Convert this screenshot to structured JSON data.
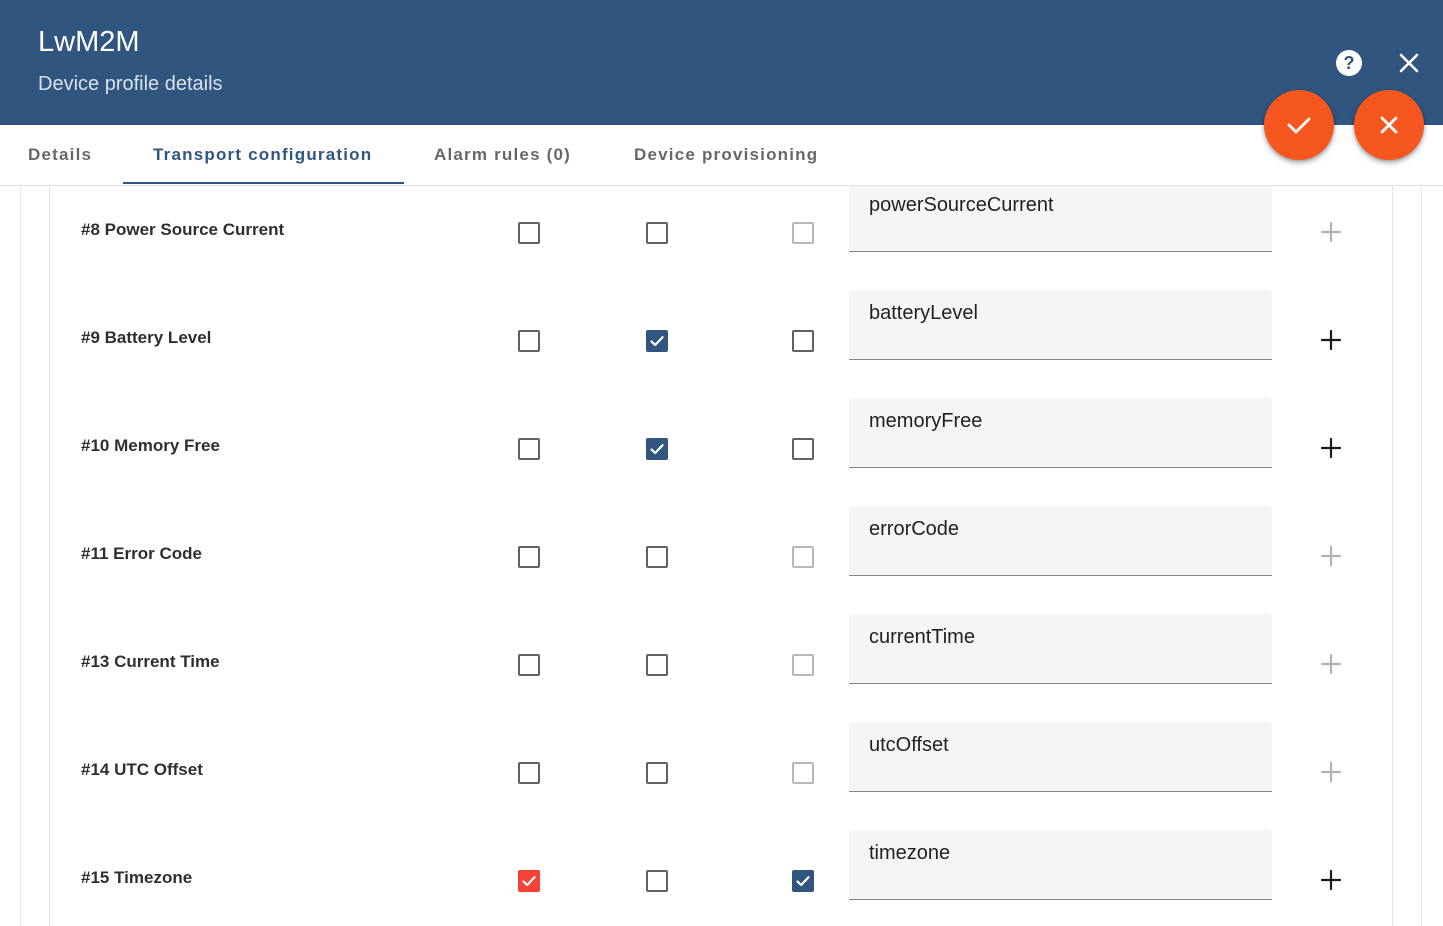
{
  "header": {
    "title": "LwM2M",
    "subtitle": "Device profile details",
    "help_icon": "help-circle-icon",
    "close_icon": "close-icon"
  },
  "fab": {
    "apply_icon": "check-icon",
    "cancel_icon": "close-icon",
    "color": "#f5571f"
  },
  "tabs": [
    {
      "label": "Details",
      "active": false
    },
    {
      "label": "Transport configuration",
      "active": true
    },
    {
      "label": "Alarm rules (0)",
      "active": false
    },
    {
      "label": "Device provisioning",
      "active": false
    }
  ],
  "colors": {
    "header_bg": "#305680",
    "accent": "#305680",
    "warn": "#f44336"
  },
  "resources": [
    {
      "label": "#8 Power Source Current",
      "observe": false,
      "attribute": false,
      "telemetry": false,
      "telemetry_disabled": true,
      "key": "powerSourceCurrent",
      "add_enabled": false
    },
    {
      "label": "#9 Battery Level",
      "observe": false,
      "attribute": true,
      "telemetry": false,
      "telemetry_disabled": false,
      "key": "batteryLevel",
      "add_enabled": true
    },
    {
      "label": "#10 Memory Free",
      "observe": false,
      "attribute": true,
      "telemetry": false,
      "telemetry_disabled": false,
      "key": "memoryFree",
      "add_enabled": true
    },
    {
      "label": "#11 Error Code",
      "observe": false,
      "attribute": false,
      "telemetry": false,
      "telemetry_disabled": true,
      "key": "errorCode",
      "add_enabled": false
    },
    {
      "label": "#13 Current Time",
      "observe": false,
      "attribute": false,
      "telemetry": false,
      "telemetry_disabled": true,
      "key": "currentTime",
      "add_enabled": false
    },
    {
      "label": "#14 UTC Offset",
      "observe": false,
      "attribute": false,
      "telemetry": false,
      "telemetry_disabled": true,
      "key": "utcOffset",
      "add_enabled": false
    },
    {
      "label": "#15 Timezone",
      "observe": true,
      "observe_warn": true,
      "attribute": false,
      "telemetry": true,
      "telemetry_disabled": false,
      "key": "timezone",
      "add_enabled": true
    }
  ]
}
